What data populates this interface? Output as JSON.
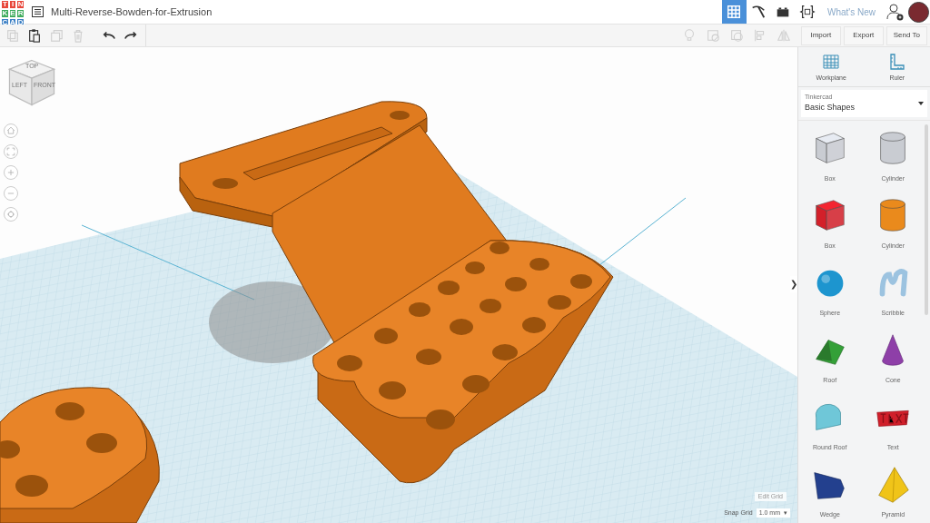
{
  "logo": {
    "letters": [
      {
        "char": "T",
        "color": "#e8473b"
      },
      {
        "char": "I",
        "color": "#e8473b"
      },
      {
        "char": "N",
        "color": "#e8473b"
      },
      {
        "char": "K",
        "color": "#3fab5c"
      },
      {
        "char": "E",
        "color": "#3fab5c"
      },
      {
        "char": "R",
        "color": "#3fab5c"
      },
      {
        "char": "C",
        "color": "#3b7fc4"
      },
      {
        "char": "A",
        "color": "#3b7fc4"
      },
      {
        "char": "D",
        "color": "#3b7fc4"
      }
    ]
  },
  "design_title": "Multi-Reverse-Bowden-for-Extrusion",
  "top_nav": [
    {
      "kind": "grid",
      "selected": true
    },
    {
      "kind": "pickaxe",
      "selected": false
    },
    {
      "kind": "bricks",
      "selected": false
    },
    {
      "kind": "codeblocks",
      "selected": false
    }
  ],
  "whats_new": "What's New",
  "edit_tools": [
    {
      "kind": "copy",
      "disabled": true
    },
    {
      "kind": "paste",
      "disabled": false
    },
    {
      "kind": "duplicate",
      "disabled": true
    },
    {
      "kind": "delete",
      "disabled": true
    },
    {
      "kind": "undo",
      "disabled": false
    },
    {
      "kind": "redo",
      "disabled": false
    }
  ],
  "view_tools": [
    {
      "kind": "bulb",
      "disabled": true
    },
    {
      "kind": "note",
      "disabled": true
    },
    {
      "kind": "group",
      "disabled": true
    },
    {
      "kind": "align",
      "disabled": true
    },
    {
      "kind": "mirror",
      "disabled": true
    }
  ],
  "actions": [
    "Import",
    "Export",
    "Send To"
  ],
  "view_cube": {
    "top": "TOP",
    "left": "LEFT",
    "front": "FRONT"
  },
  "view_controls": [
    {
      "kind": "home"
    },
    {
      "kind": "fit"
    },
    {
      "kind": "zoom-in"
    },
    {
      "kind": "zoom-out"
    },
    {
      "kind": "orbit"
    }
  ],
  "panel": {
    "tools": [
      {
        "kind": "workplane",
        "label": "Workplane"
      },
      {
        "kind": "ruler",
        "label": "Ruler"
      }
    ],
    "library": {
      "label": "Tinkercad",
      "value": "Basic Shapes"
    },
    "collapse": "❯",
    "shapes": [
      {
        "kind": "box",
        "label": "Box",
        "color": "#c9ccd2"
      },
      {
        "kind": "cylinder",
        "label": "Cylinder",
        "color": "#c9ccd2"
      },
      {
        "kind": "box",
        "label": "Box",
        "color": "#d3202a"
      },
      {
        "kind": "cylinder",
        "label": "Cylinder",
        "color": "#ea8a1c"
      },
      {
        "kind": "sphere",
        "label": "Sphere",
        "color": "#1d95cf"
      },
      {
        "kind": "scribble",
        "label": "Scribble",
        "color": "#9cc3e0"
      },
      {
        "kind": "roof",
        "label": "Roof",
        "color": "#34a038"
      },
      {
        "kind": "cone",
        "label": "Cone",
        "color": "#8e3fa8"
      },
      {
        "kind": "roundroof",
        "label": "Round Roof",
        "color": "#6fc7d8"
      },
      {
        "kind": "text",
        "label": "Text",
        "color": "#d01f2a"
      },
      {
        "kind": "wedge",
        "label": "Wedge",
        "color": "#23408e"
      },
      {
        "kind": "pyramid",
        "label": "Pyramid",
        "color": "#f0c419"
      }
    ]
  },
  "grid": {
    "edit": "Edit Grid",
    "snap_label": "Snap Grid",
    "snap_value": "1.0 mm",
    "caret": "▾"
  }
}
